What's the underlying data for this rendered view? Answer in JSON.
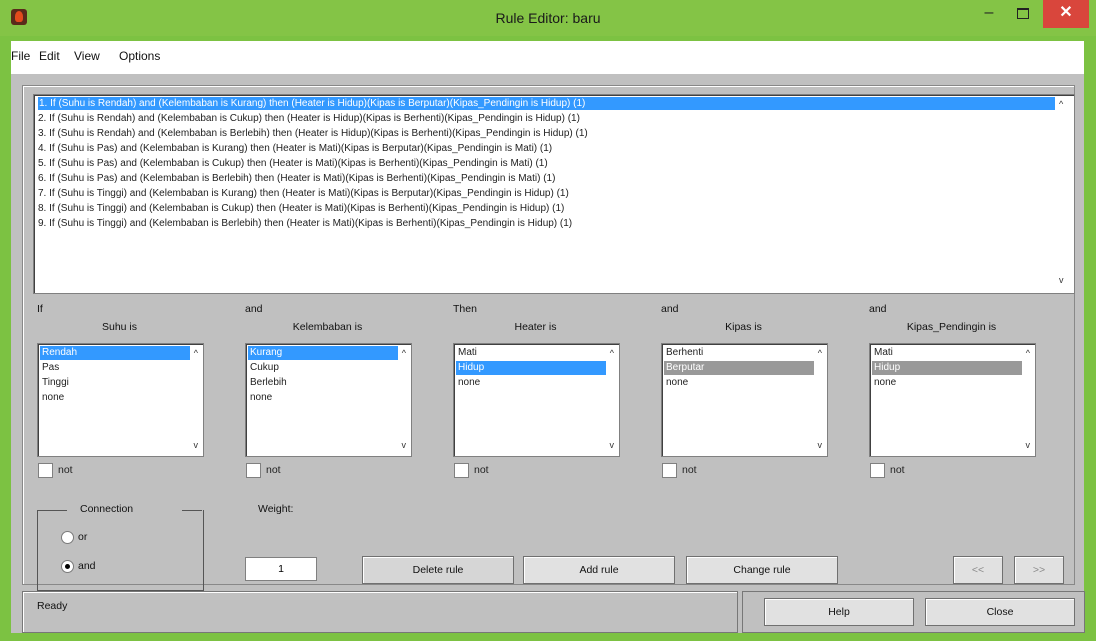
{
  "window": {
    "title": "Rule Editor: baru"
  },
  "menu": [
    "File",
    "Edit",
    "View",
    "Options"
  ],
  "rules": [
    "1. If (Suhu is Rendah) and (Kelembaban is Kurang) then (Heater is Hidup)(Kipas is Berputar)(Kipas_Pendingin is Hidup) (1)",
    "2. If (Suhu is Rendah) and (Kelembaban is Cukup) then (Heater is Hidup)(Kipas is Berhenti)(Kipas_Pendingin is Hidup) (1)",
    "3. If (Suhu is Rendah) and (Kelembaban is Berlebih) then (Heater is Hidup)(Kipas is Berhenti)(Kipas_Pendingin is Hidup) (1)",
    "4. If (Suhu is Pas) and (Kelembaban is Kurang) then (Heater is Mati)(Kipas is Berputar)(Kipas_Pendingin is Mati) (1)",
    "5. If (Suhu is Pas) and (Kelembaban is Cukup) then (Heater is Mati)(Kipas is Berhenti)(Kipas_Pendingin is Mati) (1)",
    "6. If (Suhu is Pas) and (Kelembaban is Berlebih) then (Heater is Mati)(Kipas is Berhenti)(Kipas_Pendingin is Mati) (1)",
    "7. If (Suhu is Tinggi) and (Kelembaban is Kurang) then (Heater is Mati)(Kipas is Berputar)(Kipas_Pendingin is Hidup) (1)",
    "8. If (Suhu is Tinggi) and (Kelembaban is Cukup) then (Heater is Mati)(Kipas is Berhenti)(Kipas_Pendingin is Hidup) (1)",
    "9. If (Suhu is Tinggi) and (Kelembaban is Berlebih) then (Heater is Mati)(Kipas is Berhenti)(Kipas_Pendingin is Hidup) (1)"
  ],
  "columns": [
    {
      "prefix": "If",
      "title": "Suhu is",
      "options": [
        "Rendah",
        "Pas",
        "Tinggi",
        "none"
      ],
      "not_label": "not"
    },
    {
      "prefix": "and",
      "title": "Kelembaban is",
      "options": [
        "Kurang",
        "Cukup",
        "Berlebih",
        "none"
      ],
      "not_label": "not"
    },
    {
      "prefix": "Then",
      "title": "Heater is",
      "options": [
        "Mati",
        "Hidup",
        "none"
      ],
      "not_label": "not"
    },
    {
      "prefix": "and",
      "title": "Kipas is",
      "options": [
        "Berhenti",
        "Berputar",
        "none"
      ],
      "not_label": "not"
    },
    {
      "prefix": "and",
      "title": "Kipas_Pendingin is",
      "options": [
        "Mati",
        "Hidup",
        "none"
      ],
      "not_label": "not"
    }
  ],
  "connection": {
    "title": "Connection",
    "or_label": "or",
    "and_label": "and",
    "selected": "and"
  },
  "weight": {
    "label": "Weight:",
    "value": "1"
  },
  "buttons": {
    "delete": "Delete rule",
    "add": "Add rule",
    "change": "Change rule",
    "prev": "<<",
    "next": ">>",
    "help": "Help",
    "close": "Close"
  },
  "status": "Ready"
}
